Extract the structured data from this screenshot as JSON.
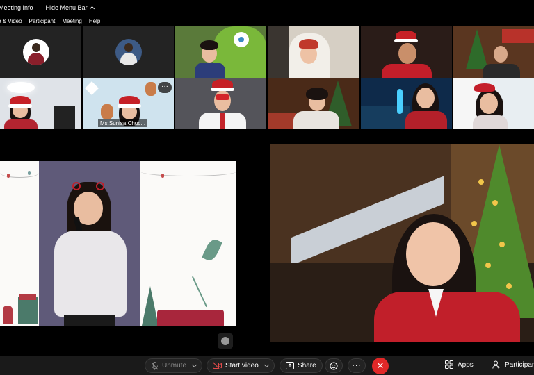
{
  "window": {
    "meeting_info": "Meeting Info",
    "hide_menu_bar": "Hide Menu Bar"
  },
  "menu": {
    "items": [
      "o & Video",
      "Participant",
      "Meeting",
      "Help"
    ]
  },
  "gallery": {
    "participants": [
      {
        "kind": "avatar"
      },
      {
        "kind": "avatar"
      },
      {
        "kind": "video"
      },
      {
        "kind": "video"
      },
      {
        "kind": "video"
      },
      {
        "kind": "video"
      },
      {
        "kind": "video"
      },
      {
        "kind": "video",
        "name": "Ms.Sunisa Chuc...",
        "more": "···"
      },
      {
        "kind": "video"
      },
      {
        "kind": "video"
      },
      {
        "kind": "video"
      },
      {
        "kind": "video"
      }
    ]
  },
  "controls": {
    "unmute": "Unmute",
    "start_video": "Start video",
    "share": "Share",
    "more": "···",
    "end": "✕",
    "apps": "Apps",
    "participants": "Participan"
  },
  "colors": {
    "end_red": "#e02828",
    "toolbar_bg": "#1a1a1a",
    "santa_red": "#c62026"
  }
}
